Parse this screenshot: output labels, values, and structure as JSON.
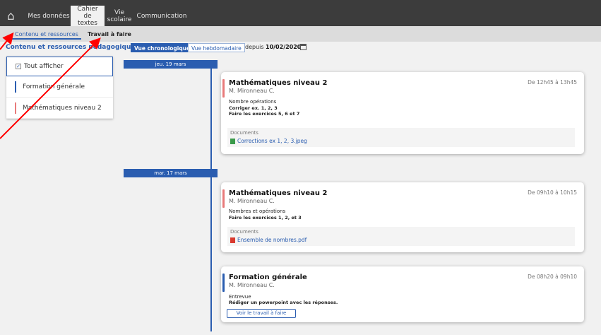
{
  "nav": {
    "items": [
      {
        "label": "Mes données"
      },
      {
        "label": "Cahier de textes"
      },
      {
        "label": "Vie scolaire"
      },
      {
        "label": "Communication"
      }
    ]
  },
  "subnav": {
    "tabs": [
      {
        "label": "Contenu et ressources"
      },
      {
        "label": "Travail à faire"
      }
    ]
  },
  "toolbar": {
    "section_title": "Contenu et ressources pédagogiques",
    "view_chrono": "Vue chronologique",
    "view_weekly": "Vue hebdomadaire",
    "depuis": "depuis",
    "date": "10/02/2020"
  },
  "filter": {
    "items": [
      {
        "label": "Tout afficher"
      },
      {
        "label": "Formation générale",
        "color": "#2a5db0"
      },
      {
        "label": "Mathématiques niveau 2",
        "color": "#e87a7a"
      }
    ]
  },
  "timeline": {
    "dates": [
      "jeu. 19 mars",
      "mar. 17 mars"
    ],
    "line_color": "#2a5db0"
  },
  "cards": [
    {
      "title": "Mathématiques niveau 2",
      "teacher": "M. Mironneau C.",
      "time": "De 12h45 à 13h45",
      "content": "Nombre opérations",
      "lines": [
        "Corriger ex. 1, 2, 3",
        "Faire les exercices 5, 6 et 7"
      ],
      "docs_label": "Documents",
      "file": "Corrections ex 1, 2, 3.jpeg",
      "color": "#e87a7a"
    },
    {
      "title": "Mathématiques niveau 2",
      "teacher": "M. Mironneau C.",
      "time": "De 09h10 à 10h15",
      "content": "Nombres et opérations",
      "lines": [
        "Faire les exercices 1, 2, et 3"
      ],
      "docs_label": "Documents",
      "file": "Ensemble de nombres.pdf",
      "color": "#e87a7a"
    },
    {
      "title": "Formation générale",
      "teacher": "M. Mironneau C.",
      "time": "De 08h20 à 09h10",
      "content": "Entrevue",
      "lines": [
        "Rédiger un powerpoint avec les réponses."
      ],
      "button": "Voir le travail à faire",
      "color": "#2a5db0"
    }
  ],
  "colors": {
    "accent": "#2a5db0",
    "annotation_arrow": "#ff0000"
  }
}
